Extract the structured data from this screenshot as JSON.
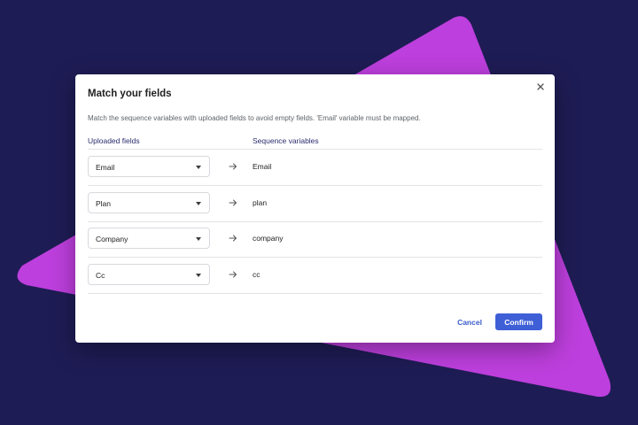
{
  "colors": {
    "background": "#1e1c54",
    "triangle": "#bd3fdd",
    "accent": "#3f5fd7",
    "header_text": "#2b2d6e"
  },
  "dialog": {
    "title": "Match your fields",
    "description": "Match the sequence variables with uploaded fields to avoid empty fields. 'Email' variable must be mapped.",
    "close_icon": "close-icon",
    "columns": {
      "uploaded": "Uploaded fields",
      "sequence": "Sequence variables"
    },
    "rows": [
      {
        "field": "Email",
        "variable": "Email"
      },
      {
        "field": "Plan",
        "variable": "plan"
      },
      {
        "field": "Company",
        "variable": "company"
      },
      {
        "field": "Cc",
        "variable": "cc"
      }
    ],
    "cancel_label": "Cancel",
    "confirm_label": "Confirm"
  }
}
